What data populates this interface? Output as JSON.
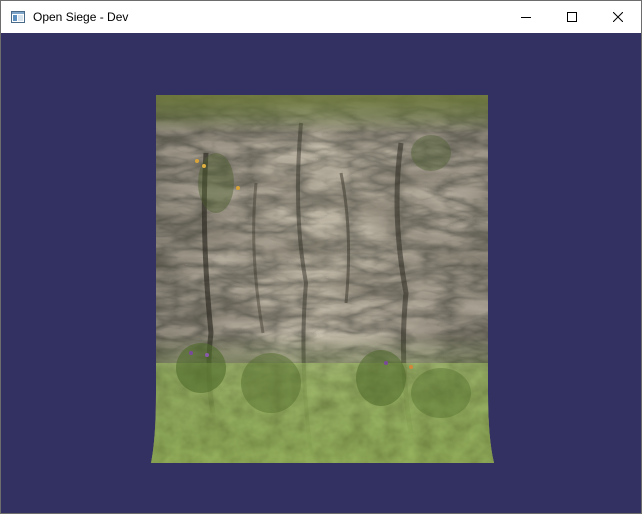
{
  "window": {
    "title": "Open Siege - Dev",
    "icon": "app-window-icon"
  },
  "controls": {
    "minimize_icon": "minimize-icon",
    "maximize_icon": "maximize-icon",
    "close_icon": "close-icon"
  },
  "viewport": {
    "background_color": "#333162",
    "content": "rock-cliff-terrain-tile"
  }
}
